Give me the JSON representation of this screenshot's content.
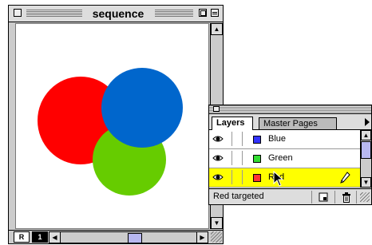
{
  "document_window": {
    "title": "sequence",
    "page_tabs": [
      "R",
      "1"
    ],
    "shapes": [
      {
        "name": "red-circle",
        "color": "#ff0000"
      },
      {
        "name": "green-circle",
        "color": "#66cc00"
      },
      {
        "name": "blue-circle",
        "color": "#0066cc"
      }
    ]
  },
  "layers_palette": {
    "tabs": [
      "Layers",
      "Master Pages"
    ],
    "active_tab": "Layers",
    "layers": [
      {
        "label": "Blue",
        "color": "#3333ff",
        "visible": true,
        "selected": false
      },
      {
        "label": "Green",
        "color": "#33dd33",
        "visible": true,
        "selected": false
      },
      {
        "label": "Red",
        "color": "#ff3333",
        "visible": true,
        "selected": true
      }
    ],
    "status": "Red targeted",
    "icons": [
      "new-layer-icon",
      "trash-icon"
    ],
    "highlight_color": "#ffff00"
  }
}
